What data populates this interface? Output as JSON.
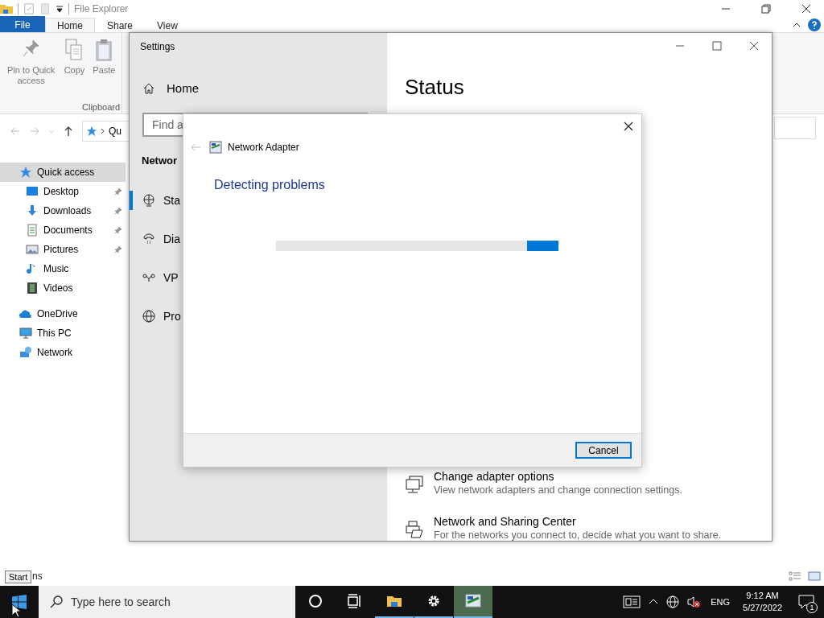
{
  "explorer": {
    "title": "File Explorer",
    "tabs": [
      {
        "label": "File",
        "kind": "file",
        "selected": false
      },
      {
        "label": "Home",
        "kind": "tab",
        "selected": true
      },
      {
        "label": "Share",
        "kind": "tab",
        "selected": false
      },
      {
        "label": "View",
        "kind": "tab",
        "selected": false
      }
    ],
    "ribbon": {
      "buttons": [
        {
          "label": "Pin to Quick access",
          "kind": "pin"
        },
        {
          "label": "Copy",
          "kind": "copy"
        },
        {
          "label": "Paste",
          "kind": "paste"
        }
      ],
      "group": "Clipboard"
    },
    "address": "Qu",
    "nav": [
      {
        "label": "Quick access",
        "kind": "star",
        "selected": true,
        "children": [
          {
            "label": "Desktop",
            "kind": "desktop",
            "pinned": true,
            "selected": false
          },
          {
            "label": "Downloads",
            "kind": "download",
            "pinned": true,
            "selected": false
          },
          {
            "label": "Documents",
            "kind": "document",
            "pinned": true,
            "selected": false
          },
          {
            "label": "Pictures",
            "kind": "pictures",
            "pinned": true,
            "selected": false
          },
          {
            "label": "Music",
            "kind": "music",
            "pinned": false,
            "selected": false
          },
          {
            "label": "Videos",
            "kind": "videos",
            "pinned": false,
            "selected": false
          }
        ]
      },
      {
        "label": "OneDrive",
        "kind": "cloud",
        "selected": false
      },
      {
        "label": "This PC",
        "kind": "pc",
        "selected": false
      },
      {
        "label": "Network",
        "kind": "network",
        "selected": false
      }
    ],
    "status": "ns"
  },
  "settings": {
    "title": "Settings",
    "home": "Home",
    "search": {
      "placeholder": "Find a"
    },
    "section": "Networ",
    "nav": [
      {
        "label": "Sta",
        "kind": "globe-pc",
        "selected": true
      },
      {
        "label": "Dia",
        "kind": "dialup",
        "selected": false
      },
      {
        "label": "VP",
        "kind": "vpn",
        "selected": false
      },
      {
        "label": "Pro",
        "kind": "globe",
        "selected": false
      }
    ],
    "page_title": "Status",
    "links": [
      {
        "title": "Change adapter options",
        "description": "View network adapters and change connection settings.",
        "kind": "adapter"
      },
      {
        "title": "Network and Sharing Center",
        "description": "For the networks you connect to, decide what you want to share.",
        "kind": "sharing"
      }
    ]
  },
  "dialog": {
    "title": "Network Adapter",
    "heading": "Detecting problems",
    "progress": {
      "indeterminate": true
    },
    "buttons": [
      "Cancel"
    ]
  },
  "taskbar": {
    "tooltip": "Start",
    "search": {
      "placeholder": "Type here to search"
    },
    "apps": [
      {
        "kind": "cortana",
        "running": false,
        "selected": false
      },
      {
        "kind": "taskview",
        "running": false,
        "selected": false
      },
      {
        "kind": "explorer",
        "running": true,
        "selected": false
      },
      {
        "kind": "settings",
        "running": true,
        "selected": false
      },
      {
        "kind": "troubleshooter",
        "running": true,
        "selected": true
      }
    ],
    "language": "ENG",
    "time": "9:12 AM",
    "date": "5/27/2022",
    "notifications": "1"
  }
}
